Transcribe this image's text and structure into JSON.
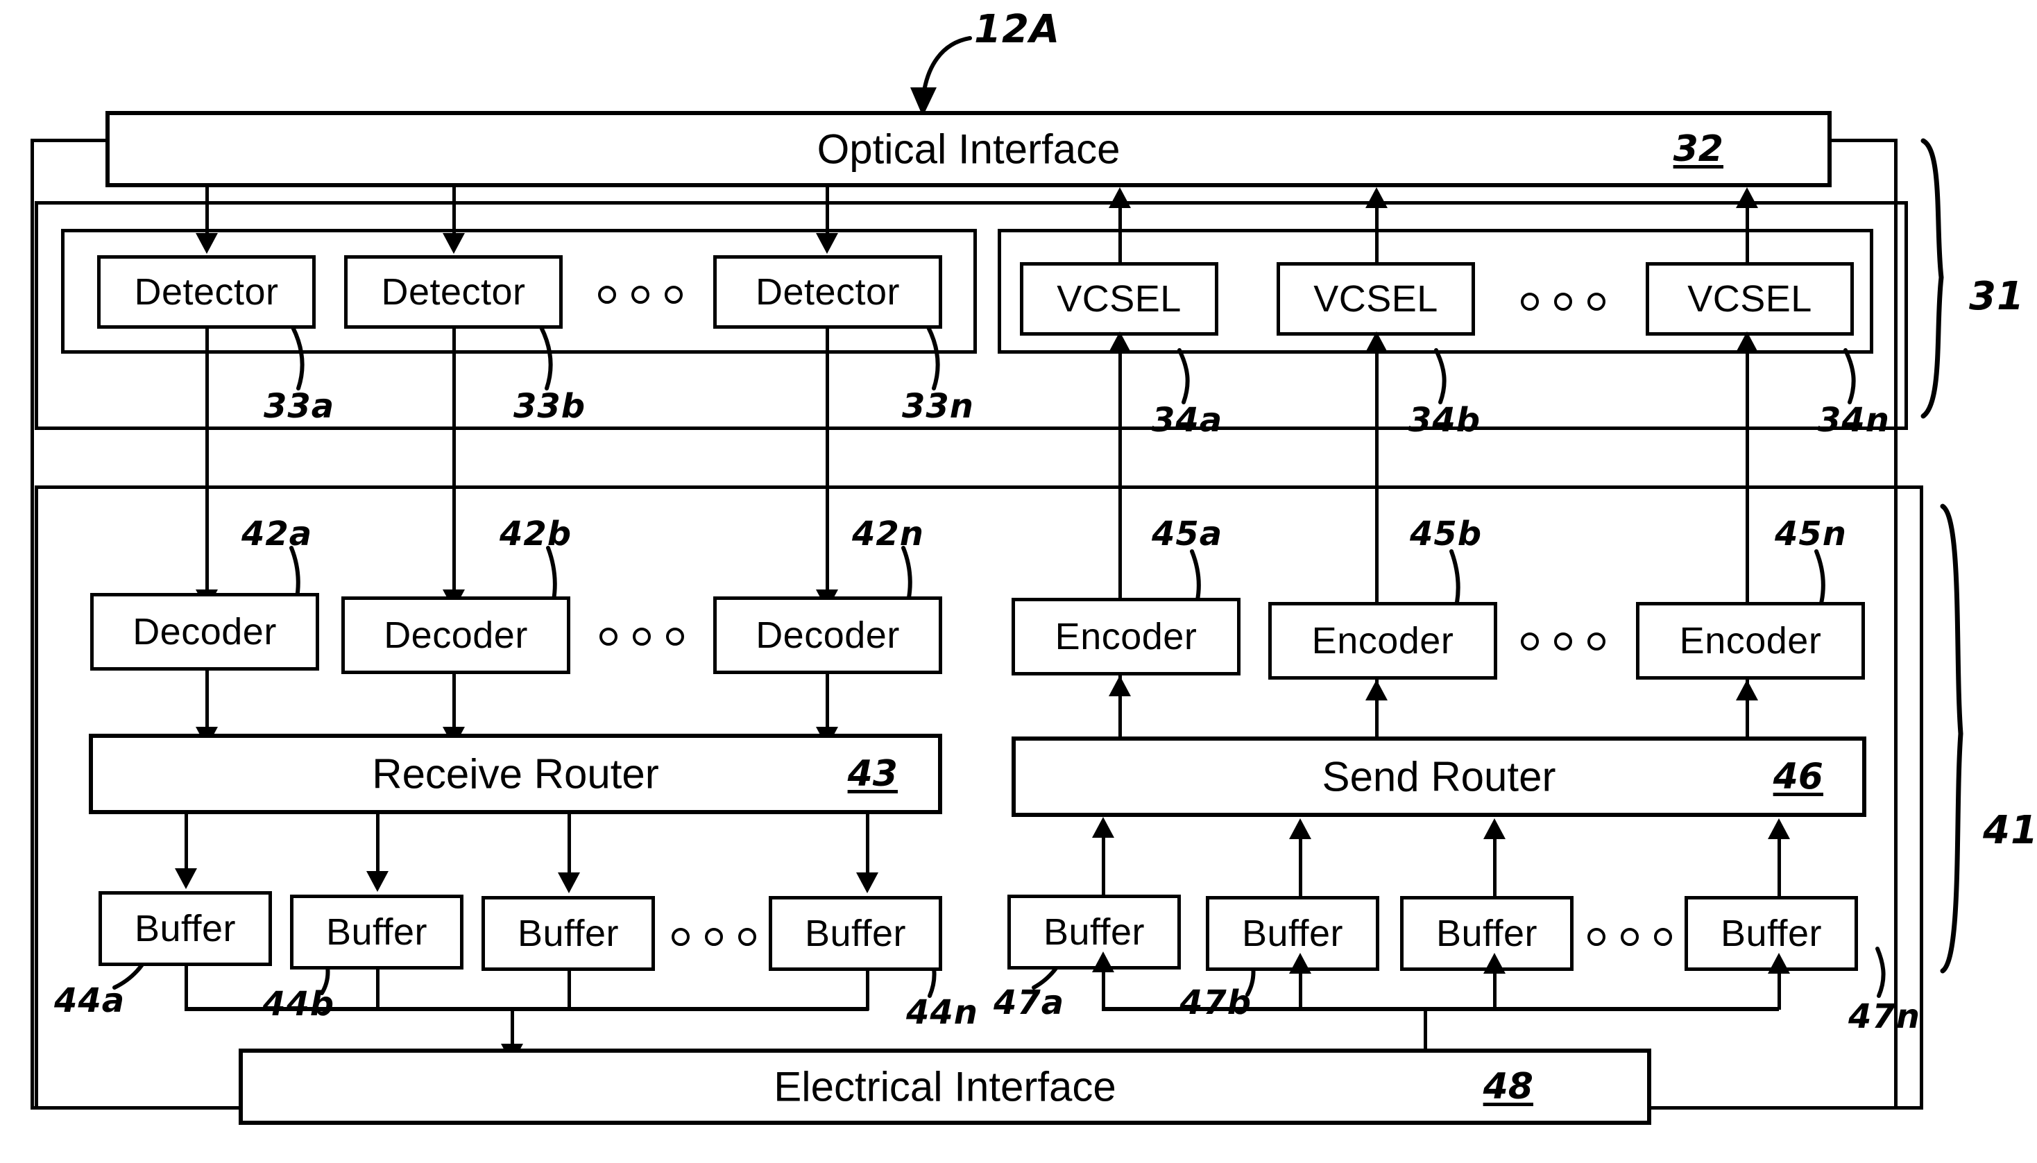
{
  "figure": {
    "ref_12a": "12A",
    "bracket_31": "31",
    "bracket_41": "41"
  },
  "optical_interface": {
    "label": "Optical Interface",
    "ref": "32"
  },
  "electrical_interface": {
    "label": "Electrical Interface",
    "ref": "48"
  },
  "receive_router": {
    "label": "Receive Router",
    "ref": "43"
  },
  "send_router": {
    "label": "Send Router",
    "ref": "46"
  },
  "detectors": {
    "label": "Detector",
    "items": [
      {
        "label": "Detector",
        "ref": "33a"
      },
      {
        "label": "Detector",
        "ref": "33b"
      },
      {
        "label": "Detector",
        "ref": "33n"
      }
    ]
  },
  "vcsels": {
    "label": "VCSEL",
    "items": [
      {
        "label": "VCSEL",
        "ref": "34a"
      },
      {
        "label": "VCSEL",
        "ref": "34b"
      },
      {
        "label": "VCSEL",
        "ref": "34n"
      }
    ]
  },
  "decoders": {
    "label": "Decoder",
    "items": [
      {
        "label": "Decoder",
        "ref": "42a"
      },
      {
        "label": "Decoder",
        "ref": "42b"
      },
      {
        "label": "Decoder",
        "ref": "42n"
      }
    ]
  },
  "encoders": {
    "label": "Encoder",
    "items": [
      {
        "label": "Encoder",
        "ref": "45a"
      },
      {
        "label": "Encoder",
        "ref": "45b"
      },
      {
        "label": "Encoder",
        "ref": "45n"
      }
    ]
  },
  "receive_buffers": {
    "label": "Buffer",
    "items": [
      {
        "label": "Buffer",
        "ref": "44a"
      },
      {
        "label": "Buffer",
        "ref": "44b"
      },
      {
        "label": "Buffer",
        "ref": ""
      },
      {
        "label": "Buffer",
        "ref": "44n"
      }
    ]
  },
  "send_buffers": {
    "label": "Buffer",
    "items": [
      {
        "label": "Buffer",
        "ref": "47a"
      },
      {
        "label": "Buffer",
        "ref": "47b"
      },
      {
        "label": "Buffer",
        "ref": ""
      },
      {
        "label": "Buffer",
        "ref": "47n"
      }
    ]
  },
  "ellipsis_glyph": "o o o",
  "colors": {
    "ink": "#000000",
    "paper": "#ffffff"
  }
}
